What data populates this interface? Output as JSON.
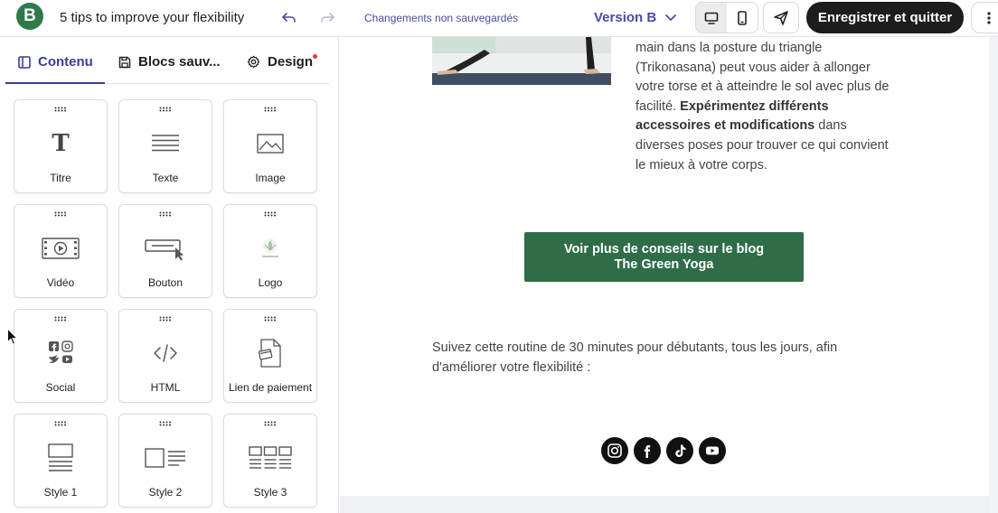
{
  "header": {
    "logo_letter": "B",
    "doc_title": "5 tips to improve your flexibility",
    "undo_icon": "undo-icon",
    "redo_icon": "redo-icon",
    "unsaved_status": "Changements non sauvegardés",
    "version_label": "Version B",
    "save_quit_label": "Enregistrer et quitter",
    "accent_color": "#4a4aa8",
    "brand_color": "#2f7a4a"
  },
  "sidebar": {
    "tabs": [
      {
        "label": "Contenu",
        "icon": "layout-icon",
        "active": true
      },
      {
        "label": "Blocs sauv...",
        "icon": "save-icon",
        "active": false
      },
      {
        "label": "Design",
        "icon": "gear-icon",
        "active": false
      }
    ],
    "blocks": [
      {
        "label": "Titre",
        "icon": "title-icon"
      },
      {
        "label": "Texte",
        "icon": "text-icon"
      },
      {
        "label": "Image",
        "icon": "image-icon"
      },
      {
        "label": "Vidéo",
        "icon": "video-icon"
      },
      {
        "label": "Bouton",
        "icon": "button-icon"
      },
      {
        "label": "Logo",
        "icon": "logo-icon"
      },
      {
        "label": "Social",
        "icon": "social-icon"
      },
      {
        "label": "HTML",
        "icon": "code-icon"
      },
      {
        "label": "Lien de paiement",
        "icon": "payment-link-icon"
      },
      {
        "label": "Style 1",
        "icon": "style1-icon"
      },
      {
        "label": "Style 2",
        "icon": "style2-icon"
      },
      {
        "label": "Style 3",
        "icon": "style3-icon"
      }
    ]
  },
  "canvas": {
    "paragraph_start": "main dans la posture du triangle (Trikonasana) peut vous aider à allonger votre torse et à atteindre le sol avec plus de facilité. ",
    "paragraph_bold": "Expérimentez différents accessoires et modifications",
    "paragraph_end": " dans diverses poses pour trouver ce qui convient le mieux à votre corps.",
    "cta_line1": "Voir plus de conseils sur le blog",
    "cta_line2": "The Green Yoga",
    "cta_color": "#2e6d48",
    "routine_text": "Suivez cette routine de 30 minutes pour débutants, tous les jours, afin d'améliorer votre flexibilité :",
    "social_icons": [
      "instagram-icon",
      "facebook-icon",
      "tiktok-icon",
      "youtube-icon"
    ]
  }
}
